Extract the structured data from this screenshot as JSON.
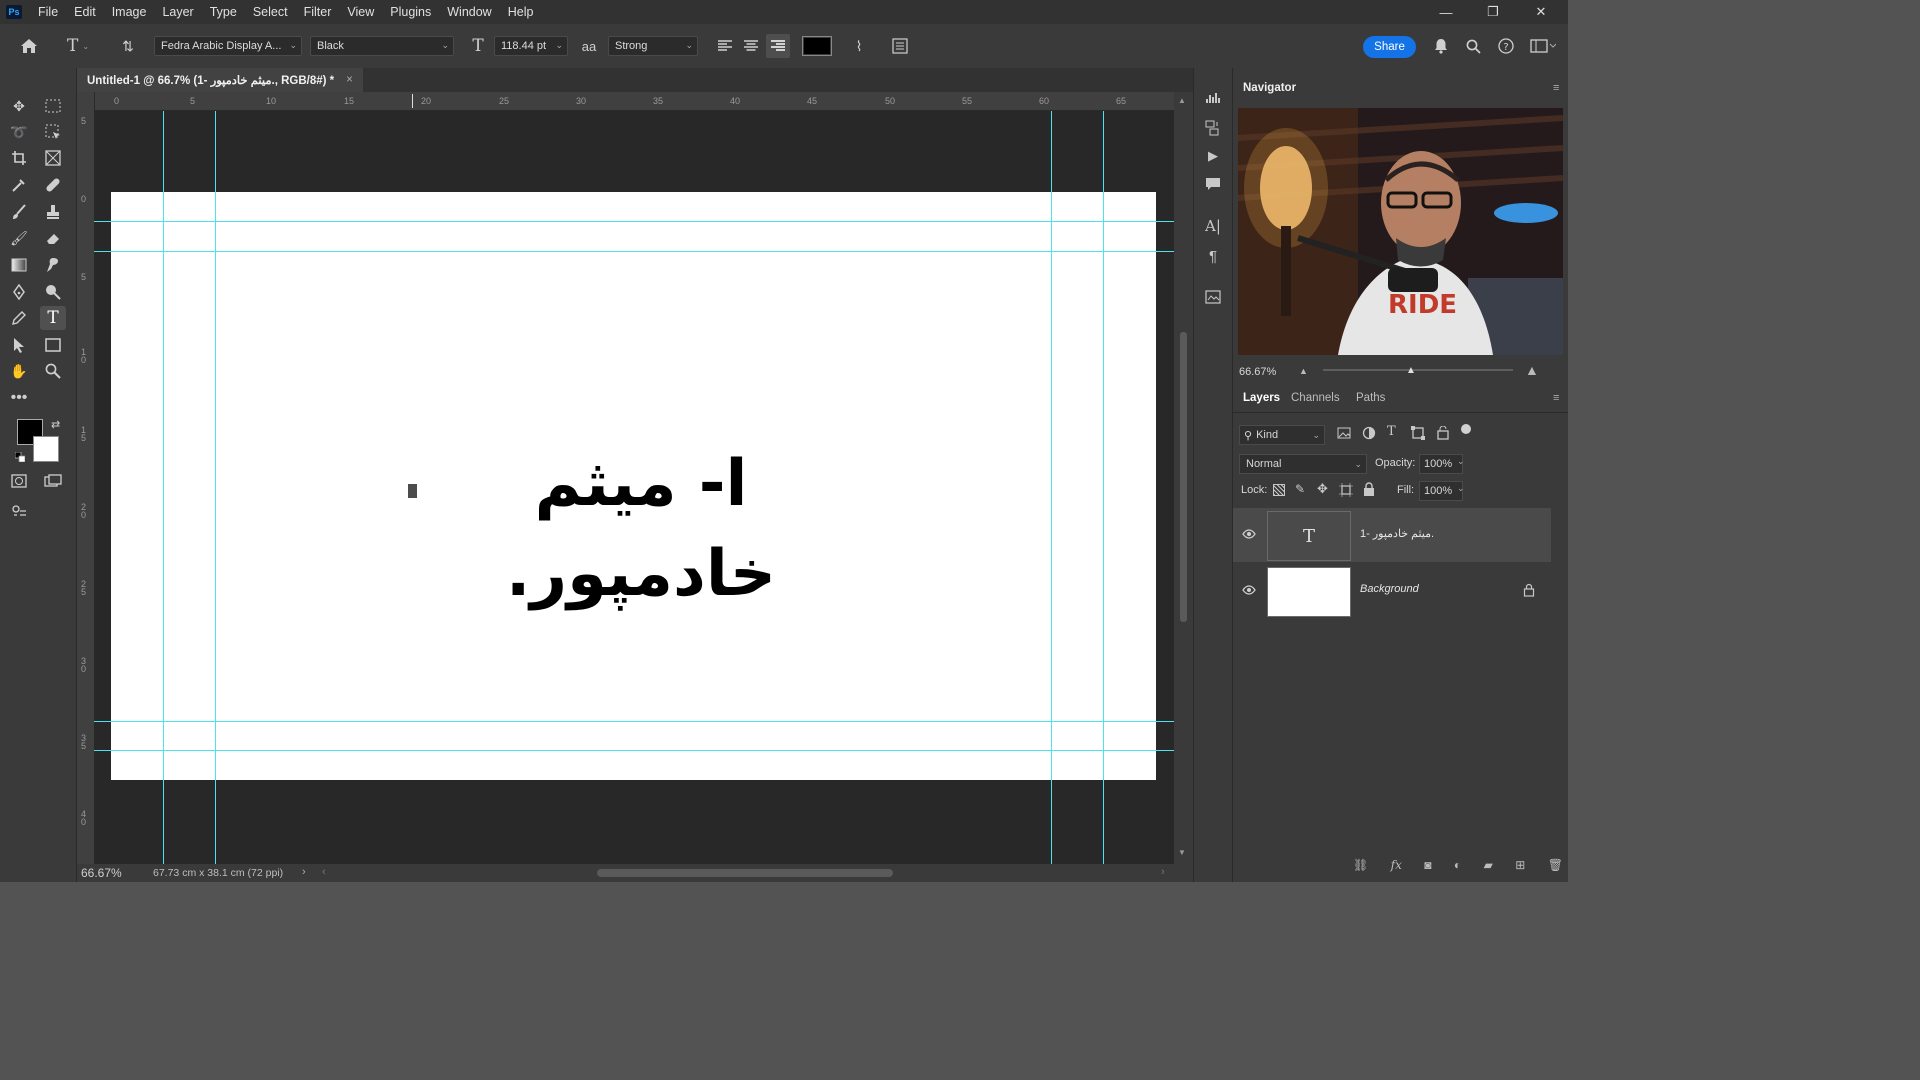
{
  "app": {
    "logo": "Ps"
  },
  "menu": [
    "File",
    "Edit",
    "Image",
    "Layer",
    "Type",
    "Select",
    "Filter",
    "View",
    "Plugins",
    "Window",
    "Help"
  ],
  "window_controls": {
    "minimize": "—",
    "restore": "❐",
    "close": "✕"
  },
  "options": {
    "font_family": "Fedra Arabic Display A...",
    "font_style": "Black",
    "font_size": "118.44 pt",
    "antialias_label": "aa",
    "antialias": "Strong",
    "text_color": "#000000",
    "share_label": "Share"
  },
  "document": {
    "tab_title": "Untitled-1 @ 66.7% (1- ميثم خادمپور., RGB/8#) *",
    "close": "×",
    "canvas_text": "ا- ميثم خادمپور.",
    "h_ruler_ticks": [
      "0",
      "5",
      "10",
      "15",
      "20",
      "25",
      "30",
      "35",
      "40",
      "45",
      "50",
      "55",
      "60",
      "65"
    ],
    "v_ruler_ticks": [
      "5",
      "0",
      "5",
      "1 0",
      "1 5",
      "2 0",
      "2 5",
      "3 0",
      "3 5",
      "4 0"
    ],
    "guide_color": "#4fe1f0"
  },
  "status": {
    "zoom": "66.67%",
    "doc_size": "67.73 cm x 38.1 cm (72 ppi)"
  },
  "navigator": {
    "title": "Navigator",
    "zoom": "66.67%"
  },
  "layers_panel": {
    "tabs": [
      "Layers",
      "Channels",
      "Paths"
    ],
    "filter_kind": "Kind",
    "blend_mode": "Normal",
    "opacity_label": "Opacity:",
    "opacity": "100%",
    "lock_label": "Lock:",
    "fill_label": "Fill:",
    "fill": "100%",
    "layers": [
      {
        "name": "1- ميثم خادمپور.",
        "type": "text",
        "thumb_glyph": "T"
      },
      {
        "name": "Background",
        "type": "background"
      }
    ]
  }
}
